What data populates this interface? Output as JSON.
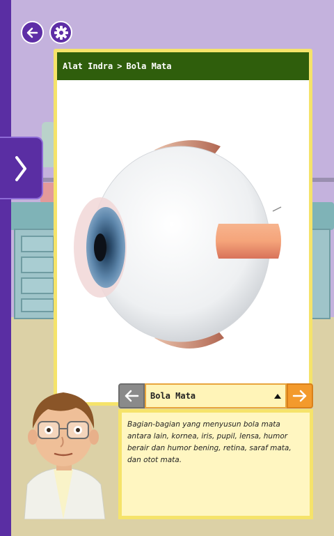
{
  "breadcrumb": {
    "parent": "Alat Indra",
    "separator": ">",
    "current": "Bola Mata"
  },
  "navigation": {
    "selected_label": "Bola Mata"
  },
  "description": {
    "text": "Bagian-bagian yang menyusun bola mata antara lain, kornea, iris, pupil, lensa, humor berair dan humor bening, retina, saraf mata, dan otot mata."
  },
  "icons": {
    "back": "arrow-left-icon",
    "settings": "gear-icon",
    "side_panel": "chevron-right-icon",
    "prev": "arrow-left-icon",
    "next": "arrow-right-icon",
    "dropdown": "caret-up-icon"
  },
  "colors": {
    "accent_purple": "#5a2ea3",
    "header_green": "#2f5e0c",
    "panel_yellow": "#f5e36a",
    "next_orange": "#f39a2c"
  }
}
